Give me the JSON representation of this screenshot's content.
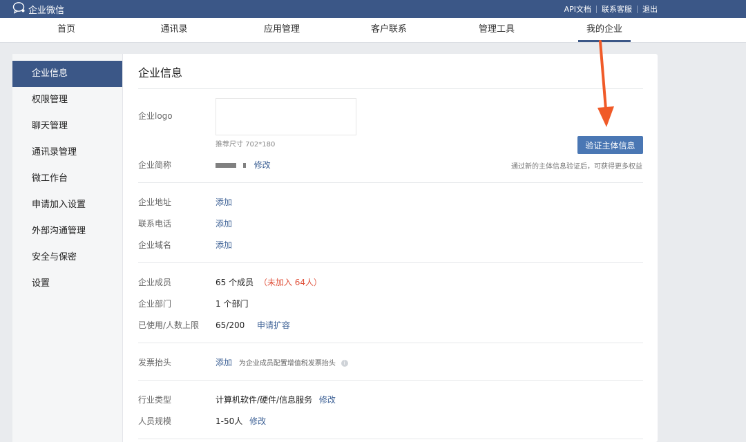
{
  "topbar": {
    "brand": "企业微信",
    "links": [
      "API文档",
      "联系客服",
      "退出"
    ]
  },
  "nav": {
    "tabs": [
      "首页",
      "通讯录",
      "应用管理",
      "客户联系",
      "管理工具",
      "我的企业"
    ],
    "active": "我的企业"
  },
  "sidebar": {
    "items": [
      "企业信息",
      "权限管理",
      "聊天管理",
      "通讯录管理",
      "微工作台",
      "申请加入设置",
      "外部沟通管理",
      "安全与保密",
      "设置"
    ],
    "active": "企业信息"
  },
  "main": {
    "title": "企业信息",
    "logo": {
      "label": "企业logo",
      "hint": "推荐尺寸 702*180"
    },
    "short_name": {
      "label": "企业简称",
      "edit": "修改"
    },
    "verify": {
      "button": "验证主体信息",
      "note": "通过新的主体信息验证后，可获得更多权益"
    },
    "address": {
      "label": "企业地址",
      "action": "添加"
    },
    "phone": {
      "label": "联系电话",
      "action": "添加"
    },
    "domain": {
      "label": "企业域名",
      "action": "添加"
    },
    "members": {
      "label": "企业成员",
      "value": "65 个成员",
      "extra": "（未加入 64人）"
    },
    "departments": {
      "label": "企业部门",
      "value": "1 个部门"
    },
    "limit": {
      "label": "已使用/人数上限",
      "value": "65/200",
      "action": "申请扩容"
    },
    "invoice": {
      "label": "发票抬头",
      "action": "添加",
      "note": "为企业成员配置增值税发票抬头"
    },
    "industry": {
      "label": "行业类型",
      "value": "计算机软件/硬件/信息服务",
      "action": "修改"
    },
    "size": {
      "label": "人员规模",
      "value": "1-50人",
      "action": "修改"
    }
  },
  "colors": {
    "topbar": "#3b5787",
    "accent": "#4a77b4",
    "link": "#3b5f94",
    "warning": "#e0533d",
    "annotation_arrow": "#f05a28"
  }
}
